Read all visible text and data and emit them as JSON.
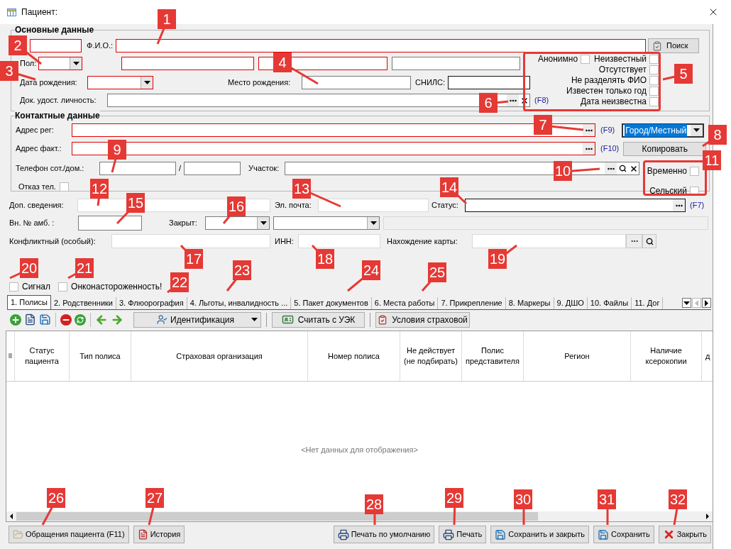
{
  "window": {
    "title": "Пациент:"
  },
  "main_group": {
    "title": "Основные данные",
    "fio_label": "Ф.И.О.:",
    "search_button": "Поиск",
    "sex_label": "Пол:",
    "birth_date_label": "Дата рождения:",
    "birth_place_label": "Место рождения:",
    "snils_label": "СНИЛС:",
    "id_doc_label": "Док. удост. личность:",
    "id_doc_hotkey": "(F8)",
    "flags": [
      {
        "label": "Анонимно",
        "checked": false
      },
      {
        "label": "Неизвестный",
        "checked": false
      },
      {
        "label": "Отсутствует",
        "checked": false
      },
      {
        "label": "Не разделять ФИО",
        "checked": false
      },
      {
        "label": "Известен только год",
        "checked": false
      },
      {
        "label": "Дата неизвестна",
        "checked": false
      }
    ]
  },
  "contacts_group": {
    "title": "Контактные данные",
    "reg_address_label": "Адрес рег:",
    "reg_hotkey": "(F9)",
    "locality": "Город/Местный",
    "fact_address_label": "Адрес факт.:",
    "fact_hotkey": "(F10)",
    "copy_button": "Копировать",
    "phone_label": "Телефон сот./дом.:",
    "phone_separator": "/",
    "district_label": "Участок:",
    "phone_refusal": {
      "label": "Отказ тел.",
      "checked": false
    },
    "flags": [
      {
        "label": "Временно",
        "checked": false
      },
      {
        "label": "Сельский",
        "checked": false
      }
    ]
  },
  "extra": {
    "additional_label": "Доп. сведения:",
    "email_label": "Эл. почта:",
    "status_label": "Статус:",
    "status_hotkey": "(F7)",
    "amb_number_label": "Вн. № амб. :",
    "closed_label": "Закрыт:",
    "conflict_label": "Конфликтный (особый):",
    "inn_label": "ИНН:",
    "card_location_label": "Нахождение карты:",
    "signals": [
      {
        "label": "Сигнал",
        "checked": false
      },
      {
        "label": "Онконастороженность!",
        "checked": false
      }
    ]
  },
  "tabs": [
    {
      "label": "1. Полисы",
      "selected": true
    },
    {
      "label": "2. Родственники",
      "selected": false
    },
    {
      "label": "3. Флюорография",
      "selected": false
    },
    {
      "label": "4. Льготы, инвалидность ...",
      "selected": false
    },
    {
      "label": "5. Пакет документов",
      "selected": false
    },
    {
      "label": "6. Места работы",
      "selected": false
    },
    {
      "label": "7. Прикрепление",
      "selected": false
    },
    {
      "label": "8. Маркеры",
      "selected": false
    },
    {
      "label": "9. ДШО",
      "selected": false
    },
    {
      "label": "10. Файлы",
      "selected": false
    },
    {
      "label": "11. Дог",
      "selected": false
    }
  ],
  "toolbar": {
    "identify_button": "Идентификация",
    "read_card_button": "Считать с УЭК",
    "insurance_button": "Условия страховой"
  },
  "table": {
    "columns": [
      "Статус пациента",
      "Тип полиса",
      "Страховая организация",
      "Номер полиса",
      "Не действует (не подбирать)",
      "Полис представителя",
      "Регион",
      "Наличие ксерокопии",
      "д"
    ],
    "empty_text": "<Нет данных для отображения>"
  },
  "footer": {
    "left": [
      {
        "label": "Обращения пациента (F11)",
        "kind": "appeals"
      },
      {
        "label": "История",
        "kind": "history"
      }
    ],
    "right": [
      {
        "label": "Печать по умолчанию",
        "kind": "print"
      },
      {
        "label": "Печать",
        "kind": "print"
      },
      {
        "label": "Сохранить и закрыть",
        "kind": "save"
      },
      {
        "label": "Сохранить",
        "kind": "save"
      },
      {
        "label": "Закрыть",
        "kind": "close"
      }
    ]
  },
  "callouts": [
    "1",
    "2",
    "3",
    "4",
    "5",
    "6",
    "7",
    "8",
    "9",
    "10",
    "11",
    "12",
    "13",
    "14",
    "15",
    "16",
    "17",
    "18",
    "19",
    "20",
    "21",
    "22",
    "23",
    "24",
    "25",
    "26",
    "27",
    "28",
    "29",
    "30",
    "31",
    "32"
  ]
}
